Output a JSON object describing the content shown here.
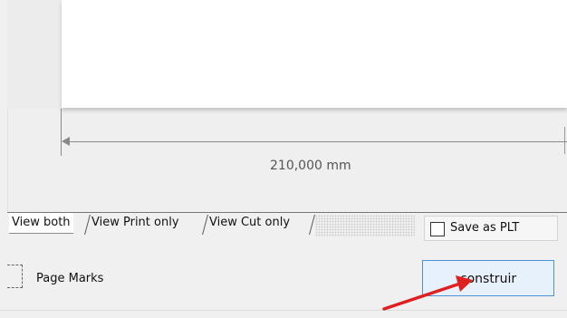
{
  "preview": {
    "dimension_label": "210,000 mm"
  },
  "tabs": [
    {
      "label": "View both"
    },
    {
      "label": "View Print only"
    },
    {
      "label": "View Cut only"
    }
  ],
  "options": {
    "save_plt_label": "Save as PLT",
    "save_plt_checked": false,
    "page_marks_label": "Page Marks"
  },
  "actions": {
    "build_label": "construir"
  },
  "annotation": {
    "arrow_color": "#e02020"
  },
  "colors": {
    "button_bg": "#e7f1fb",
    "button_border": "#4e92d6"
  }
}
